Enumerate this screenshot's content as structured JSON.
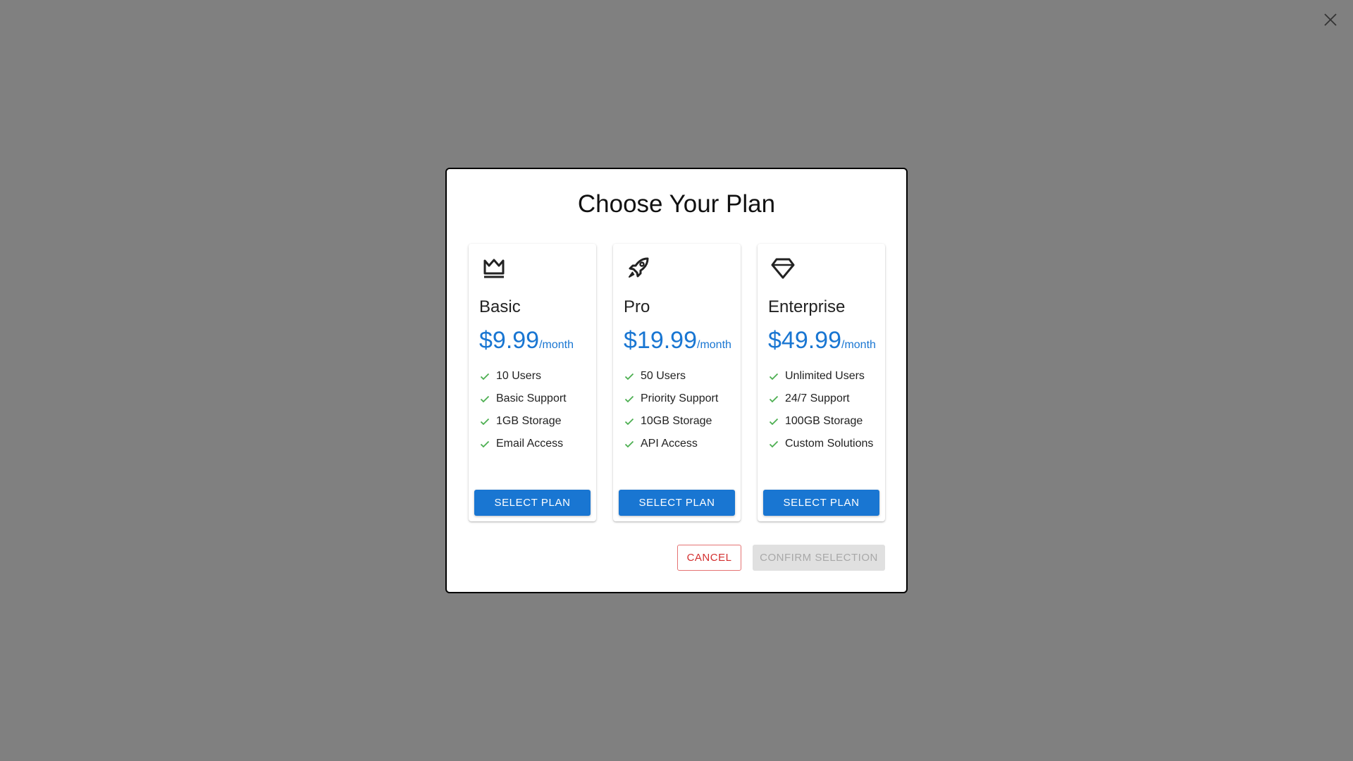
{
  "dialog": {
    "title": "Choose Your Plan",
    "cancel_label": "CANCEL",
    "confirm_label": "CONFIRM SELECTION"
  },
  "plans": [
    {
      "name": "Basic",
      "icon": "crown-icon",
      "price": "$9.99",
      "period": "/month",
      "features": [
        "10 Users",
        "Basic Support",
        "1GB Storage",
        "Email Access"
      ],
      "button_label": "SELECT PLAN"
    },
    {
      "name": "Pro",
      "icon": "rocket-icon",
      "price": "$19.99",
      "period": "/month",
      "features": [
        "50 Users",
        "Priority Support",
        "10GB Storage",
        "API Access"
      ],
      "button_label": "SELECT PLAN"
    },
    {
      "name": "Enterprise",
      "icon": "diamond-icon",
      "price": "$49.99",
      "period": "/month",
      "features": [
        "Unlimited Users",
        "24/7 Support",
        "100GB Storage",
        "Custom Solutions"
      ],
      "button_label": "SELECT PLAN"
    }
  ],
  "colors": {
    "accent": "#1976d2",
    "check": "#4caf50",
    "cancel": "#d32f2f",
    "overlay": "#808080"
  }
}
